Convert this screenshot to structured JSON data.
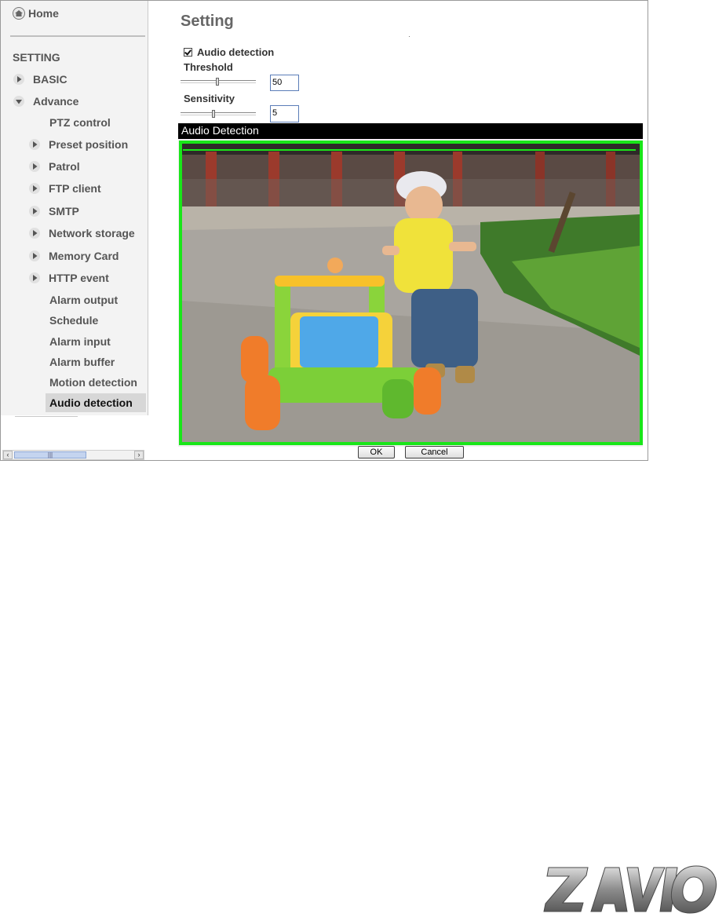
{
  "sidebar": {
    "home_label": "Home",
    "section_label": "SETTING",
    "items": [
      {
        "label": "BASIC",
        "arrow": true
      },
      {
        "label": "Advance",
        "arrow": true
      },
      {
        "label": "PTZ control",
        "arrow": false
      },
      {
        "label": "Preset position",
        "arrow": true
      },
      {
        "label": "Patrol",
        "arrow": true
      },
      {
        "label": "FTP client",
        "arrow": true
      },
      {
        "label": "SMTP",
        "arrow": true
      },
      {
        "label": "Network storage",
        "arrow": true
      },
      {
        "label": "Memory Card",
        "arrow": true
      },
      {
        "label": "HTTP event",
        "arrow": true
      },
      {
        "label": "Alarm output",
        "arrow": false
      },
      {
        "label": "Schedule",
        "arrow": false
      },
      {
        "label": "Alarm input",
        "arrow": false
      },
      {
        "label": "Alarm buffer",
        "arrow": false
      },
      {
        "label": "Motion detection",
        "arrow": false
      },
      {
        "label": "Audio detection",
        "arrow": false,
        "selected": true
      }
    ]
  },
  "main": {
    "title": "Setting",
    "audio_detection_checkbox": {
      "label": "Audio detection",
      "checked": true
    },
    "threshold": {
      "label": "Threshold",
      "value": "50"
    },
    "sensitivity": {
      "label": "Sensitivity",
      "value": "5"
    },
    "detection_panel": {
      "title": "Audio Detection"
    },
    "ok_label": "OK",
    "cancel_label": "Cancel"
  },
  "colors": {
    "detection_border": "#19e619",
    "panel_bar": "#000000"
  },
  "logo_text": "ZAVIO"
}
